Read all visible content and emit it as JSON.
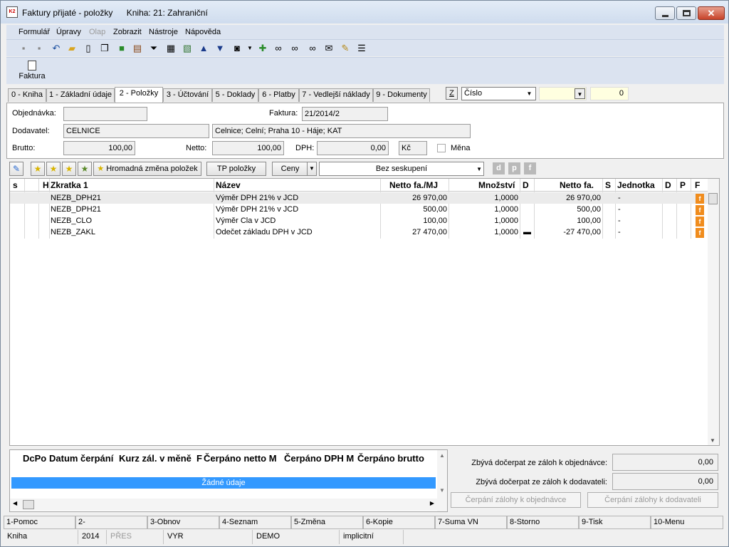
{
  "window": {
    "title": "Faktury přijaté - položky",
    "book": "Kniha: 21: Zahraniční",
    "app_icon": "K2",
    "min_icon": "minimize-icon",
    "max_icon": "maximize-icon",
    "close_glyph": "✕"
  },
  "menu": [
    "Formulář",
    "Úpravy",
    "Olap",
    "Zobrazit",
    "Nástroje",
    "Nápověda"
  ],
  "ribbon": {
    "faktura_label": "Faktura"
  },
  "tabs": [
    "0 - Kniha",
    "1 - Základní údaje",
    "2 - Položky",
    "3 - Účtování",
    "5 - Doklady",
    "6 - Platby",
    "7 - Vedlejší náklady",
    "9 - Dokumenty"
  ],
  "active_tab": 2,
  "tab_tools": {
    "z_button": "Z",
    "sort_combo": "Číslo",
    "search_value": "",
    "count": "0"
  },
  "form": {
    "objednavka_label": "Objednávka:",
    "objednavka_value": "",
    "faktura_label": "Faktura:",
    "faktura_value": "21/2014/2",
    "dodavatel_label": "Dodavatel:",
    "dodavatel_value": "CELNICE",
    "dodavatel_detail": "Celnice; Celní; Praha 10 - Háje; KAT",
    "brutto_label": "Brutto:",
    "brutto_value": "100,00",
    "netto_label": "Netto:",
    "netto_value": "100,00",
    "dph_label": "DPH:",
    "dph_value": "0,00",
    "currency": "Kč",
    "mena_label": "Měna"
  },
  "gridbar": {
    "mass_change": "Hromadná změna položek",
    "tp_polozky": "TP položky",
    "ceny": "Ceny",
    "grouping": "Bez seskupení",
    "dis_d": "d",
    "dis_p": "p",
    "dis_f": "f"
  },
  "grid": {
    "headers": [
      "s",
      "H",
      "Zkratka 1",
      "Název",
      "Netto fa./MJ",
      "Množství",
      "D",
      "Netto fa.",
      "S",
      "Jednotka",
      "D",
      "P",
      "F"
    ],
    "rows": [
      {
        "zkratka": "NEZB_DPH21",
        "nazev": "Výměr DPH  21% v JCD",
        "netto_mj": "26 970,00",
        "mnozstvi": "1,0000",
        "d": "",
        "netto": "26 970,00",
        "jednotka": "-",
        "f": "f"
      },
      {
        "zkratka": "NEZB_DPH21",
        "nazev": "Výměr DPH  21% v JCD",
        "netto_mj": "500,00",
        "mnozstvi": "1,0000",
        "d": "",
        "netto": "500,00",
        "jednotka": "-",
        "f": "f"
      },
      {
        "zkratka": "NEZB_CLO",
        "nazev": "Výměr Cla v JCD",
        "netto_mj": "100,00",
        "mnozstvi": "1,0000",
        "d": "",
        "netto": "100,00",
        "jednotka": "-",
        "f": "f"
      },
      {
        "zkratka": "NEZB_ZAKL",
        "nazev": "Odečet základu DPH v JCD",
        "netto_mj": "27 470,00",
        "mnozstvi": "1,0000",
        "d": "▬",
        "netto": "-27 470,00",
        "jednotka": "-",
        "f": "f"
      }
    ]
  },
  "advances": {
    "headers": [
      "DcPo",
      "Datum čerpání",
      "Kurz zál. v měně",
      "F",
      "Čerpáno netto M",
      "Čerpáno DPH M",
      "Čerpáno brutto"
    ],
    "empty": "Žádné údaje",
    "remain_order_label": "Zbývá dočerpat ze záloh k objednávce:",
    "remain_order_value": "0,00",
    "remain_supplier_label": "Zbývá dočerpat ze záloh k dodavateli:",
    "remain_supplier_value": "0,00",
    "btn_order": "Čerpání zálohy k objednávce",
    "btn_supplier": "Čerpání zálohy k dodavateli"
  },
  "fkeys": [
    "1-Pomoc",
    "2-",
    "3-Obnov",
    "4-Seznam",
    "5-Změna",
    "6-Kopie",
    "7-Suma VN",
    "8-Storno",
    "9-Tisk",
    "10-Menu"
  ],
  "status": [
    "Kniha",
    "2014",
    "PŘES",
    "VYR",
    "DEMO",
    "implicitní"
  ]
}
